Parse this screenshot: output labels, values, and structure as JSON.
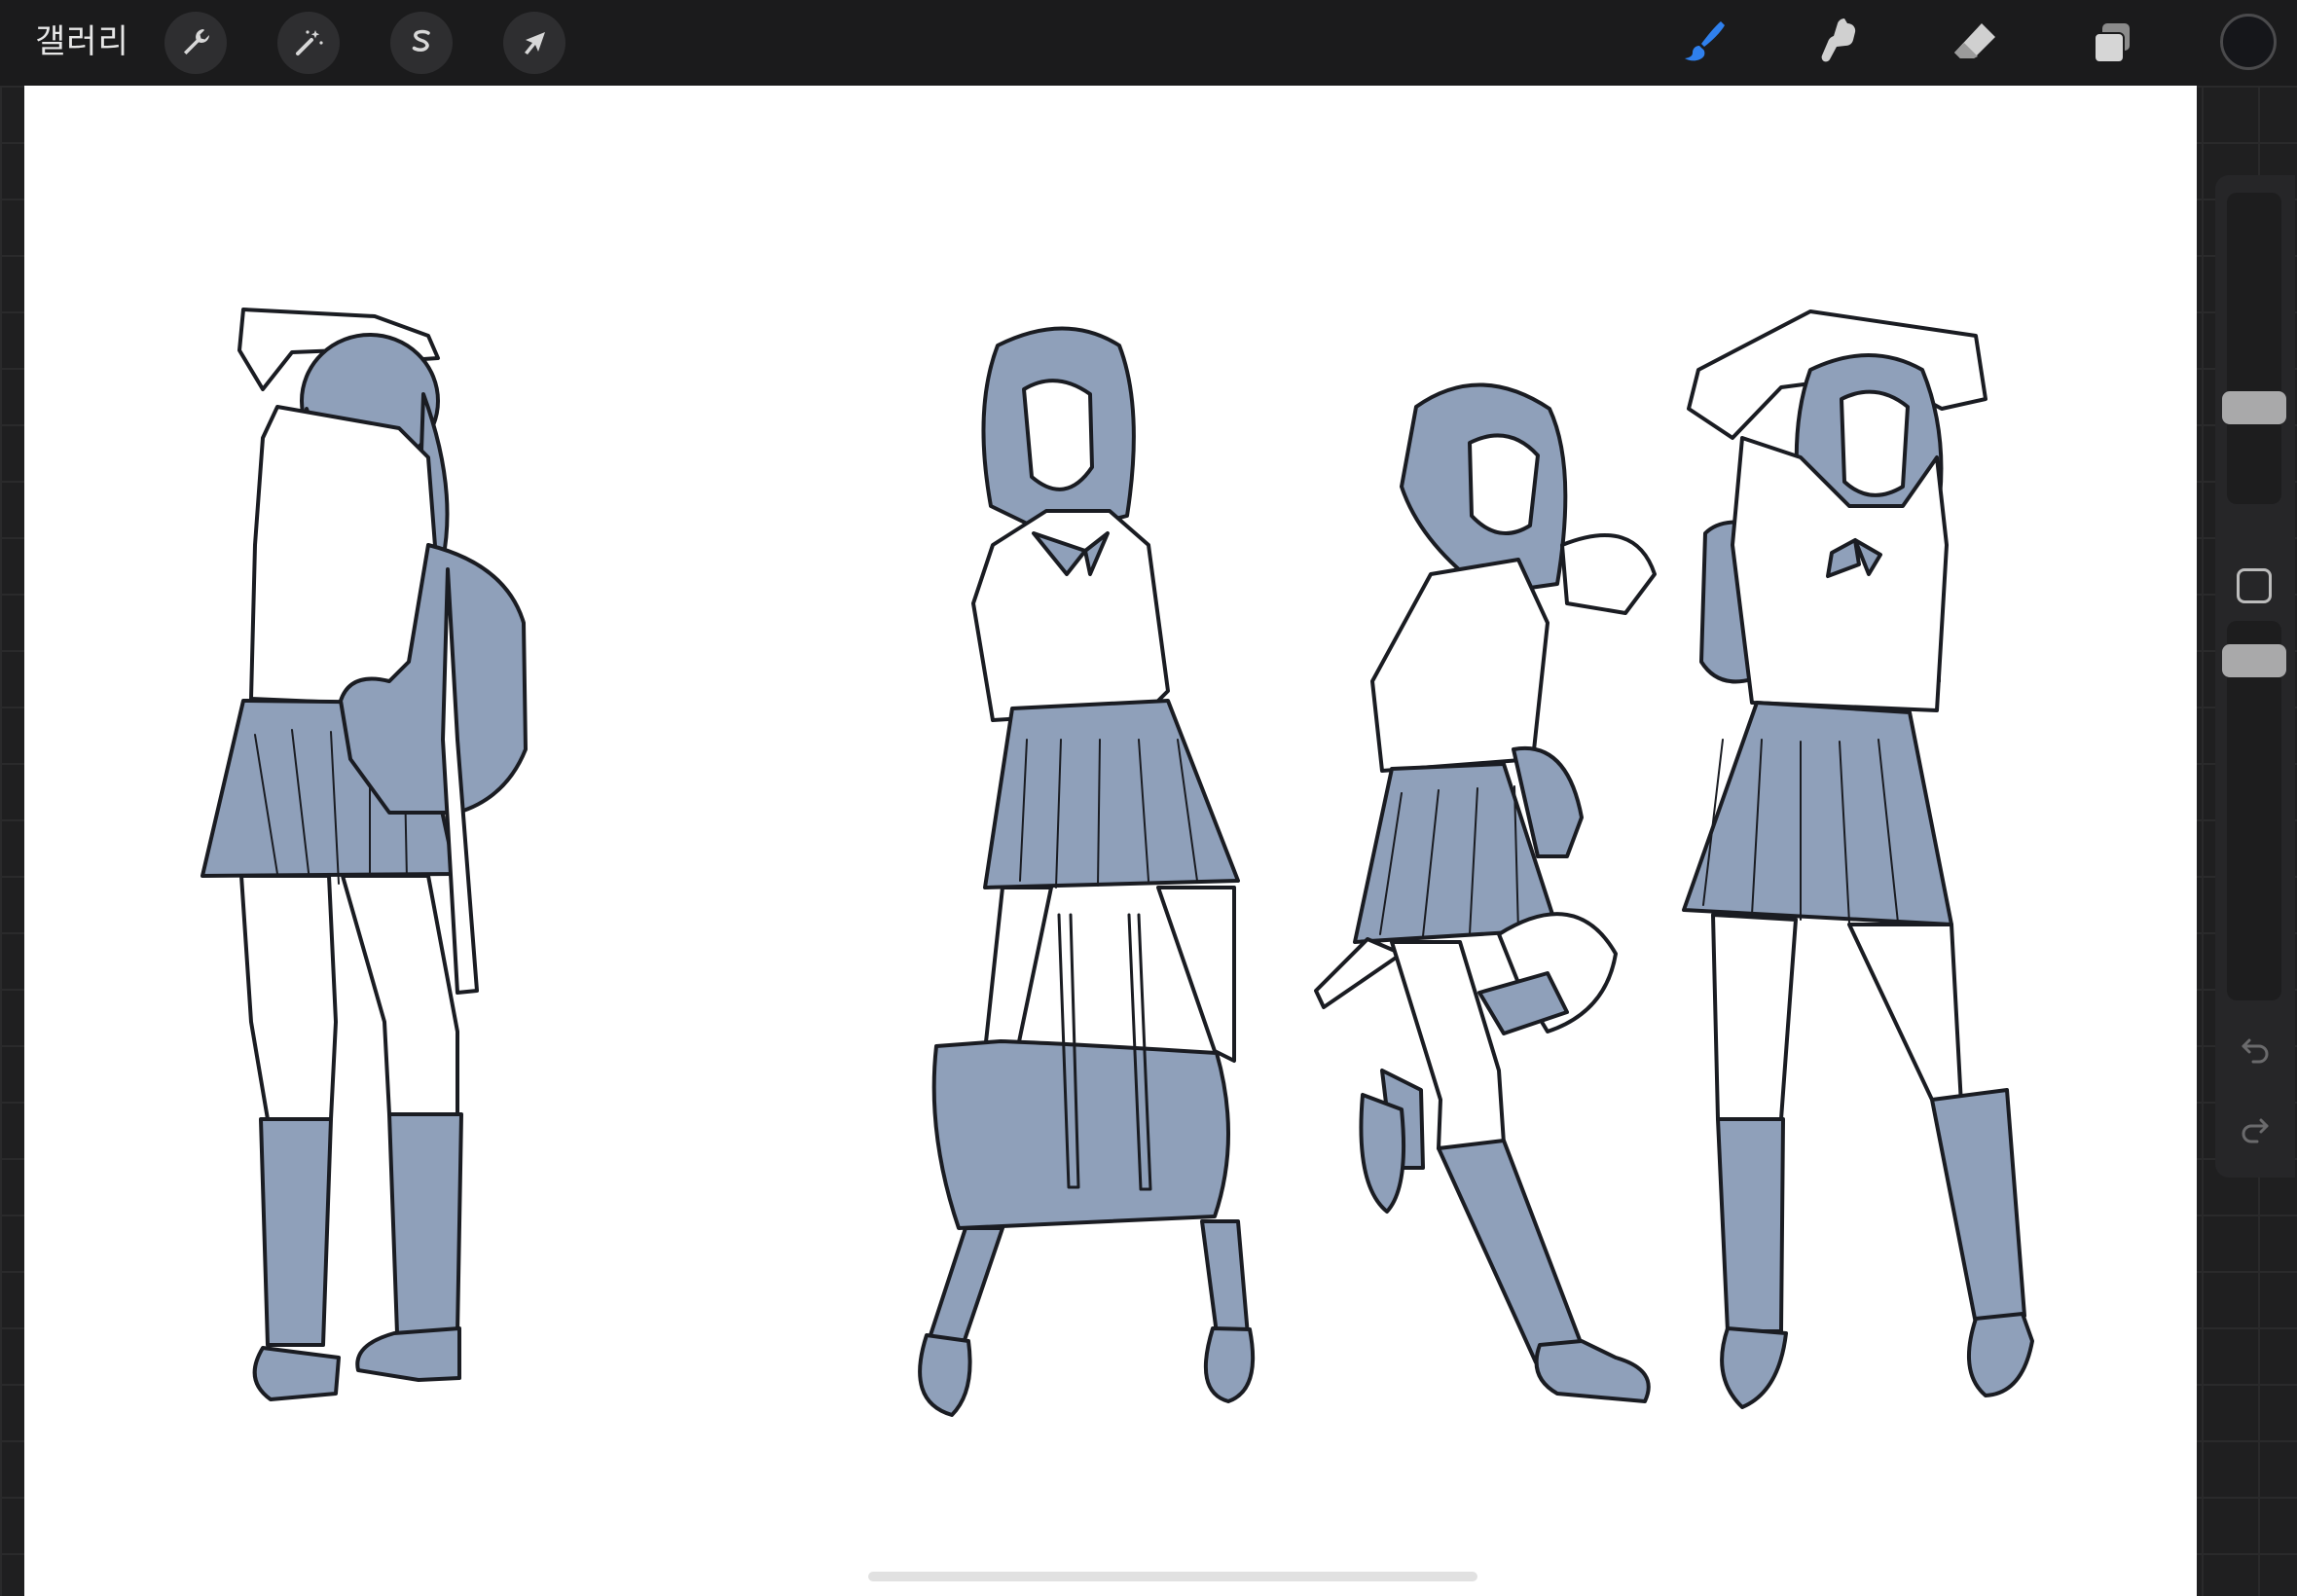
{
  "toolbar": {
    "gallery_label": "갤러리",
    "actions_icon": "wrench-icon",
    "adjustments_icon": "magic-wand-icon",
    "selection_icon": "selection-s-icon",
    "transform_icon": "arrow-cursor-icon",
    "brush_icon": "brush-icon",
    "smudge_icon": "smudge-finger-icon",
    "eraser_icon": "eraser-icon",
    "layers_icon": "layers-icon",
    "active_tool": "brush",
    "active_color": "#15161a",
    "accent_color": "#2f80ed"
  },
  "canvas": {
    "background": "#ffffff",
    "fill_color": "#8fa0ba",
    "line_color": "#1a1c22",
    "figures": [
      "figure-back-view-arms-up-bag-on-shoulder",
      "figure-front-holding-bag",
      "figure-leg-raised-hand-behind-head",
      "figure-arms-over-head-backpack"
    ]
  },
  "sidebar": {
    "brush_size_level": 0.64,
    "opacity_level": 0.9,
    "modify_icon": "square-modify-icon",
    "undo_icon": "undo-icon",
    "redo_icon": "redo-icon"
  }
}
